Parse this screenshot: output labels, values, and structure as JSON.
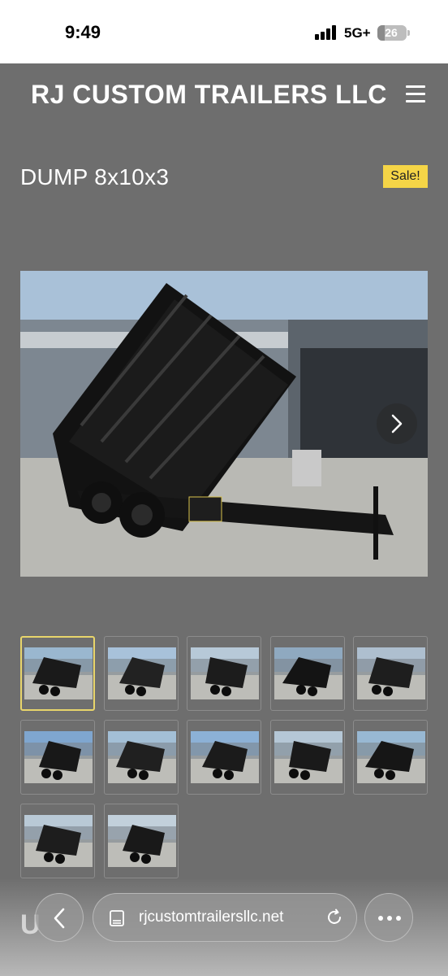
{
  "status_bar": {
    "time": "9:49",
    "network": "5G+",
    "battery": "26",
    "battery_level": 0.26
  },
  "header": {
    "site_title": "RJ CUSTOM TRAILERS LLC",
    "menu_icon": "hamburger-menu-icon"
  },
  "product": {
    "title": "DUMP 8x10x3",
    "badge": "Sale!"
  },
  "gallery": {
    "next_icon": "chevron-right-icon",
    "thumbnail_count": 12,
    "selected_thumbnail": 1
  },
  "below_fold": {
    "peek_text": "U"
  },
  "browser": {
    "back_icon": "chevron-left-icon",
    "url": "rjcustomtrailersllc.net",
    "reader_icon": "page-icon",
    "reload_icon": "reload-icon",
    "more_icon": "more-dots-icon"
  },
  "colors": {
    "page_bg": "#6e6e6e",
    "sale_badge": "#f5d547",
    "thumb_selected_border": "#e8d56b"
  }
}
